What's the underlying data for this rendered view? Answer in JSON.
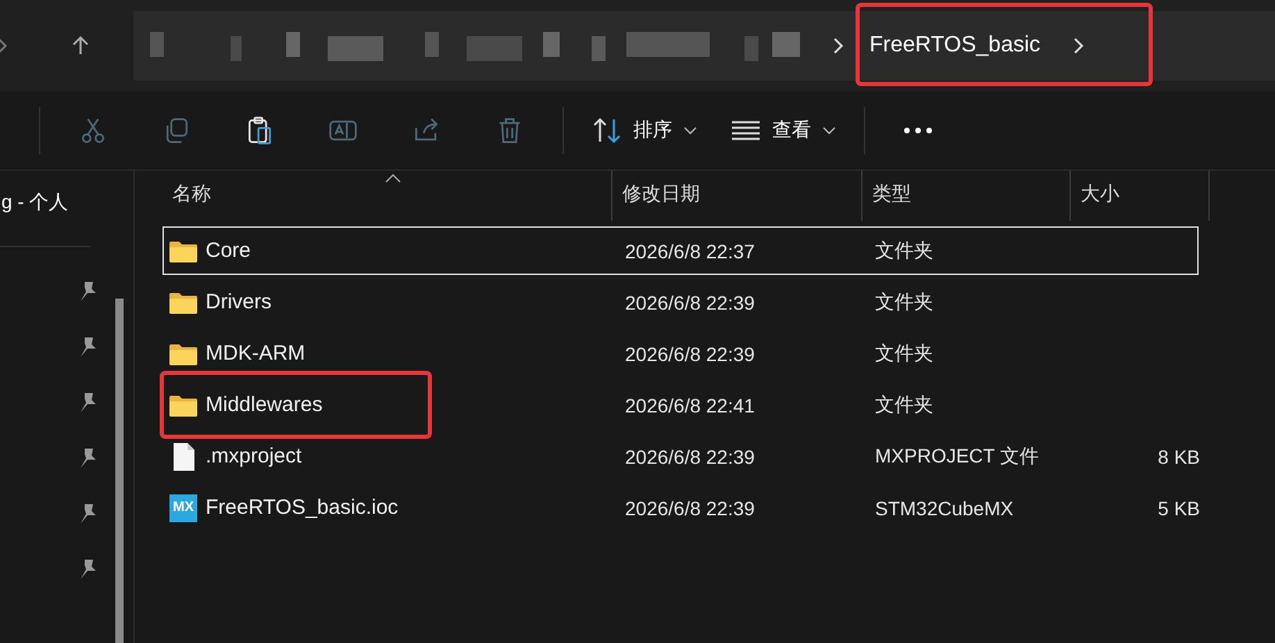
{
  "address_bar": {
    "crumbs": [
      {
        "label": "FreeRTOS_basic",
        "annotated": true
      }
    ]
  },
  "toolbar": {
    "buttons": [
      {
        "kind": "cut",
        "disabled": true
      },
      {
        "kind": "copy",
        "disabled": true
      },
      {
        "kind": "paste",
        "disabled": false
      },
      {
        "kind": "rename",
        "disabled": true
      },
      {
        "kind": "share",
        "disabled": true
      },
      {
        "kind": "delete",
        "disabled": true
      }
    ],
    "sort": {
      "label": "排序"
    },
    "view": {
      "label": "查看"
    }
  },
  "sidebar": {
    "label": "g - 个人"
  },
  "table": {
    "columns": [
      "名称",
      "修改日期",
      "类型",
      "大小"
    ],
    "rows": [
      {
        "kind": "folder",
        "name": "Core",
        "date": "2026/6/8 22:37",
        "type": "文件夹",
        "size": "",
        "selected": true,
        "annotated": false
      },
      {
        "kind": "folder",
        "name": "Drivers",
        "date": "2026/6/8 22:39",
        "type": "文件夹",
        "size": "",
        "selected": false,
        "annotated": false
      },
      {
        "kind": "folder",
        "name": "MDK-ARM",
        "date": "2026/6/8 22:39",
        "type": "文件夹",
        "size": "",
        "selected": false,
        "annotated": false
      },
      {
        "kind": "folder",
        "name": "Middlewares",
        "date": "2026/6/8 22:41",
        "type": "文件夹",
        "size": "",
        "selected": false,
        "annotated": true
      },
      {
        "kind": "file",
        "name": ".mxproject",
        "date": "2026/6/8 22:39",
        "type": "MXPROJECT 文件",
        "size": "8 KB",
        "selected": false,
        "annotated": false
      },
      {
        "kind": "cubemx",
        "badge": "MX",
        "name": "FreeRTOS_basic.ioc",
        "date": "2026/6/8 22:39",
        "type": "STM32CubeMX",
        "size": "5 KB",
        "selected": false,
        "annotated": false
      }
    ]
  }
}
